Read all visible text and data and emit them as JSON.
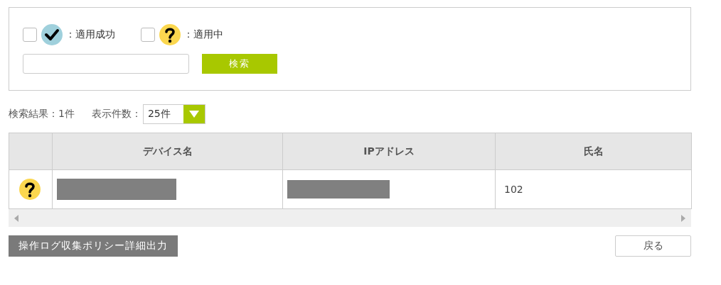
{
  "filters": [
    {
      "kind": "success",
      "label": "：適用成功",
      "checked": false
    },
    {
      "kind": "pending",
      "label": "：適用中",
      "checked": false
    }
  ],
  "search": {
    "button": "検索"
  },
  "result_count": "検索結果：1件",
  "page_size": {
    "label": "表示件数：",
    "value": "25件"
  },
  "table": {
    "columns": [
      "デバイス名",
      "IPアドレス",
      "氏名"
    ],
    "rows": [
      {
        "kind": "pending",
        "device_redacted": true,
        "ip_redacted": true,
        "name": "102"
      }
    ]
  },
  "buttons": {
    "export": "操作ログ収集ポリシー詳細出力",
    "back": "戻る"
  }
}
